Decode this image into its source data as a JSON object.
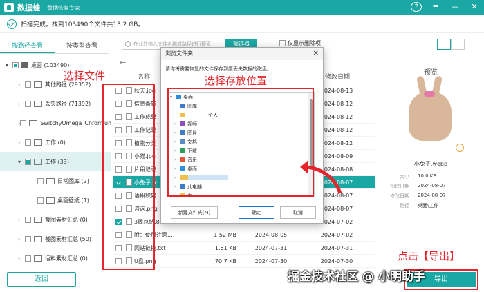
{
  "app": {
    "name": "数据蛙",
    "tagline": "数据恢复专家"
  },
  "window_controls": {
    "help": "?",
    "menu": "≡",
    "minimize": "—",
    "close": "✕"
  },
  "status": {
    "text": "扫描完成。找到103490个文件共13.2 GB。"
  },
  "tabs": [
    {
      "label": "按路径查看",
      "active": true
    },
    {
      "label": "按类型查看",
      "active": false
    }
  ],
  "search": {
    "placeholder": "在此处输入文件名称或路径进行搜索"
  },
  "filter_button": "筛选器",
  "only_deleted": "仅显示删除项",
  "tree": [
    {
      "label": "桌面 (103490)",
      "level": 0,
      "arrow": "▾",
      "state": "part",
      "type": "drive"
    },
    {
      "label": "其他路径 (29352)",
      "level": 1,
      "arrow": "›",
      "state": "off"
    },
    {
      "label": "丢失路径 (71392)",
      "level": 1,
      "arrow": "›",
      "state": "off"
    },
    {
      "label": "SwitchyOmega_Chromium",
      "level": 1,
      "arrow": "›",
      "state": "off"
    },
    {
      "label": "工作 (0)",
      "level": 1,
      "arrow": "›",
      "state": "off"
    },
    {
      "label": "工作 (33)",
      "level": 1,
      "arrow": "▾",
      "state": "part",
      "selected": true
    },
    {
      "label": "日常图库 (2)",
      "level": 2,
      "arrow": "",
      "state": "off"
    },
    {
      "label": "桌面壁纸 (1)",
      "level": 2,
      "arrow": "",
      "state": "off"
    },
    {
      "label": "截图素材汇总 (0)",
      "level": 1,
      "arrow": "›",
      "state": "off"
    },
    {
      "label": "截图素材汇总 (50)",
      "level": 1,
      "arrow": "›",
      "state": "off"
    },
    {
      "label": "语料素材汇总 (0)",
      "level": 1,
      "arrow": "›",
      "state": "off"
    }
  ],
  "back_button": "返回",
  "nav": {
    "back": "←"
  },
  "columns": {
    "name": "名称",
    "size": "",
    "created": "",
    "modified": "修改日期"
  },
  "files": [
    {
      "name": "秋天.jpg",
      "size": "",
      "created": "",
      "modified": "2024-08-13",
      "checked": false
    },
    {
      "name": "信息备忘",
      "size": "",
      "created": "",
      "modified": "2024-08-12",
      "checked": false
    },
    {
      "name": "工作成果",
      "size": "",
      "created": "",
      "modified": "2024-08-12",
      "checked": false
    },
    {
      "name": "工作记录",
      "size": "",
      "created": "",
      "modified": "2024-08-12",
      "checked": false
    },
    {
      "name": "植物分类",
      "size": "",
      "created": "",
      "modified": "2024-08-12",
      "checked": false
    },
    {
      "name": "小猫.jpg",
      "size": "",
      "created": "",
      "modified": "2024-08-09",
      "checked": false
    },
    {
      "name": "片段记录",
      "size": "",
      "created": "",
      "modified": "2024-08-08",
      "checked": false
    },
    {
      "name": "小兔子.w",
      "size": "",
      "created": "",
      "modified": "2024-08-07",
      "checked": true,
      "selected": true
    },
    {
      "name": "语段积累",
      "size": "",
      "created": "",
      "modified": "2024-08-07",
      "checked": false
    },
    {
      "name": "咨询.png",
      "size": "",
      "created": "",
      "modified": "2024-08-07",
      "checked": false
    },
    {
      "name": "3周总结.8c",
      "size": "",
      "created": "",
      "modified": "2024-07-02",
      "checked": true
    },
    {
      "name": "附：使用注意...",
      "size": "1.52 MB",
      "created": "2024-08-05",
      "modified": "2024-07-02",
      "checked": false
    },
    {
      "name": "网站链接.txt",
      "size": "1.51 KB",
      "created": "2024-07-31",
      "modified": "2024-07-31",
      "checked": false
    },
    {
      "name": "U盘.png",
      "size": "70.7 KB",
      "created": "2024-07-30",
      "modified": "2024-07-30",
      "checked": false
    }
  ],
  "preview": {
    "title": "预览",
    "filename": "小兔子.webp",
    "meta": [
      {
        "key": "大小",
        "value": "10.0 KB"
      },
      {
        "key": "创建日期",
        "value": "2024-08-07"
      },
      {
        "key": "修改日期",
        "value": "2024-08-07"
      },
      {
        "key": "路径",
        "value": "桌面\\工作"
      }
    ]
  },
  "export_button": "导出",
  "annotations": {
    "select_files": "选择文件",
    "select_location": "选择存放位置",
    "click_export": "点击【导出】"
  },
  "dialog": {
    "title": "浏览文件夹",
    "instruction": "请你将需要恢复的文件保存到原丢失数据的磁盘。",
    "tree": [
      {
        "label": "桌面",
        "level": 0,
        "arrow": "▾",
        "color": "#2f8fdc"
      },
      {
        "label": "图库",
        "level": 1,
        "arrow": "",
        "color": "#3d7cc9"
      },
      {
        "label": "个人",
        "level": 1,
        "arrow": "",
        "color": "#f0c24a"
      },
      {
        "label": "视频",
        "level": 1,
        "arrow": "›",
        "color": "#8e4fc2"
      },
      {
        "label": "图片",
        "level": 1,
        "arrow": "›",
        "color": "#3d7cc9"
      },
      {
        "label": "文档",
        "level": 1,
        "arrow": "›",
        "color": "#5a8ac6"
      },
      {
        "label": "下载",
        "level": 1,
        "arrow": "›",
        "color": "#2d9d5a"
      },
      {
        "label": "音乐",
        "level": 1,
        "arrow": "›",
        "color": "#e1573c"
      },
      {
        "label": "桌面",
        "level": 1,
        "arrow": "›",
        "color": "#2f8fdc"
      },
      {
        "label": "",
        "level": 1,
        "arrow": "›",
        "color": "#f0c24a"
      },
      {
        "label": "此电脑",
        "level": 1,
        "arrow": "›",
        "color": "#3d7cc9"
      },
      {
        "label": "库",
        "level": 1,
        "arrow": "›",
        "color": "#f0c24a"
      }
    ],
    "new_folder": "新建文件夹(M)",
    "ok": "确定",
    "cancel": "取消",
    "close": "✕"
  },
  "watermark": "掘金技术社区 @ 小明助手",
  "colors": {
    "accent": "#1ba7a3",
    "annotation": "#e5242b"
  }
}
